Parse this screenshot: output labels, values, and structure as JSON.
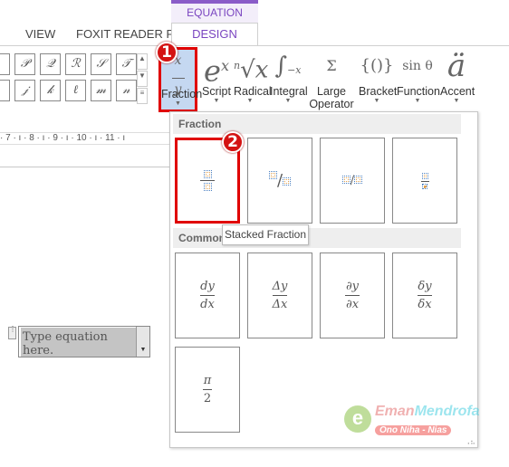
{
  "tabs": {
    "view": "VIEW",
    "foxit": "FOXIT READER PDF",
    "context_group": "EQUATION TOOLS",
    "design": "DESIGN"
  },
  "symbols": {
    "row1": [
      "𝒫",
      "𝒬",
      "ℛ",
      "𝒮",
      "𝒯"
    ],
    "row2": [
      "𝒿",
      "𝓀",
      "ℓ",
      "𝓂",
      "𝓃"
    ]
  },
  "ribbon": [
    {
      "id": "fraction",
      "label": "Fraction",
      "icon": "x/y"
    },
    {
      "id": "script",
      "label": "Script",
      "icon": "eˣ"
    },
    {
      "id": "radical",
      "label": "Radical",
      "icon": "ⁿ√x"
    },
    {
      "id": "integral",
      "label": "Integral",
      "icon": "∫"
    },
    {
      "id": "large-operator",
      "label": "Large Operator",
      "label1": "Large",
      "label2": "Operator",
      "icon": "Σ"
    },
    {
      "id": "bracket",
      "label": "Bracket",
      "icon": "{()}"
    },
    {
      "id": "function",
      "label": "Function",
      "icon": "sin θ"
    },
    {
      "id": "accent",
      "label": "Accent",
      "icon": "ä"
    }
  ],
  "badges": [
    "1",
    "2"
  ],
  "ruler": "· 7 · ı · 8 · ı · 9 · ı · 10 · ı · 11 · ı",
  "gallery": {
    "section1": "Fraction",
    "section2": "Common Fraction",
    "tooltip": "Stacked Fraction",
    "common": [
      {
        "num": "dy",
        "den": "dx"
      },
      {
        "num": "Δy",
        "den": "Δx"
      },
      {
        "num": "∂y",
        "den": "∂x"
      },
      {
        "num": "δy",
        "den": "δx"
      },
      {
        "num": "π",
        "den": "2"
      }
    ]
  },
  "equation": {
    "placeholder": "Type equation here."
  },
  "watermark": {
    "line1": "EmanMendrofa",
    "line2": "Ono Niha - Nias"
  },
  "colors": {
    "accent": "#7a45c0",
    "highlight": "#c5d8f1",
    "callout": "#e00000"
  }
}
